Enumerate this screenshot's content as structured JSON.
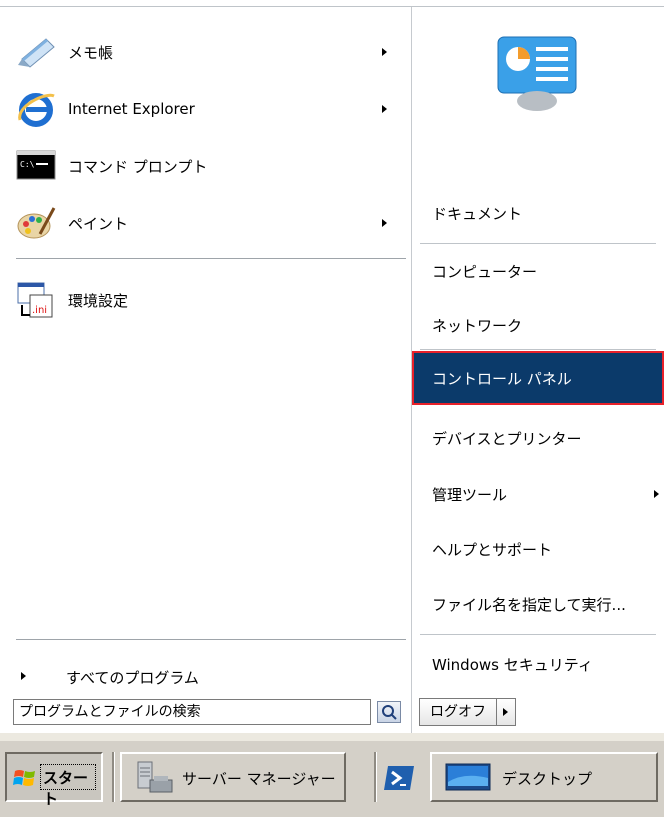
{
  "programs": [
    {
      "label": "メモ帳",
      "icon": "notepad-icon",
      "submenu": true
    },
    {
      "label": "Internet Explorer",
      "icon": "internet-explorer-icon",
      "submenu": true
    },
    {
      "label": "コマンド プロンプト",
      "icon": "command-prompt-icon",
      "submenu": false
    },
    {
      "label": "ペイント",
      "icon": "paint-icon",
      "submenu": true
    },
    {
      "label": "環境設定",
      "icon": "ini-settings-icon",
      "submenu": false
    }
  ],
  "all_programs_label": "すべてのプログラム",
  "right_items": [
    {
      "label": "ドキュメント",
      "submenu": false
    },
    {
      "label": "コンピューター",
      "submenu": false
    },
    {
      "label": "ネットワーク",
      "submenu": false
    },
    {
      "label": "コントロール パネル",
      "submenu": false,
      "selected": true
    },
    {
      "label": "デバイスとプリンター",
      "submenu": false
    },
    {
      "label": "管理ツール",
      "submenu": true
    },
    {
      "label": "ヘルプとサポート",
      "submenu": false
    },
    {
      "label": "ファイル名を指定して実行...",
      "submenu": false
    },
    {
      "label": "Windows セキュリティ",
      "submenu": false
    }
  ],
  "search": {
    "placeholder": "プログラムとファイルの検索"
  },
  "logoff_label": "ログオフ",
  "taskbar": {
    "start_label": "スタート",
    "server_manager_label": "サーバー マネージャー",
    "desktop_label": "デスクトップ"
  },
  "colors": {
    "selected_bg": "#0b3a6a",
    "highlight_border": "#e8212a",
    "taskbar_bg": "#d4d0c8"
  }
}
